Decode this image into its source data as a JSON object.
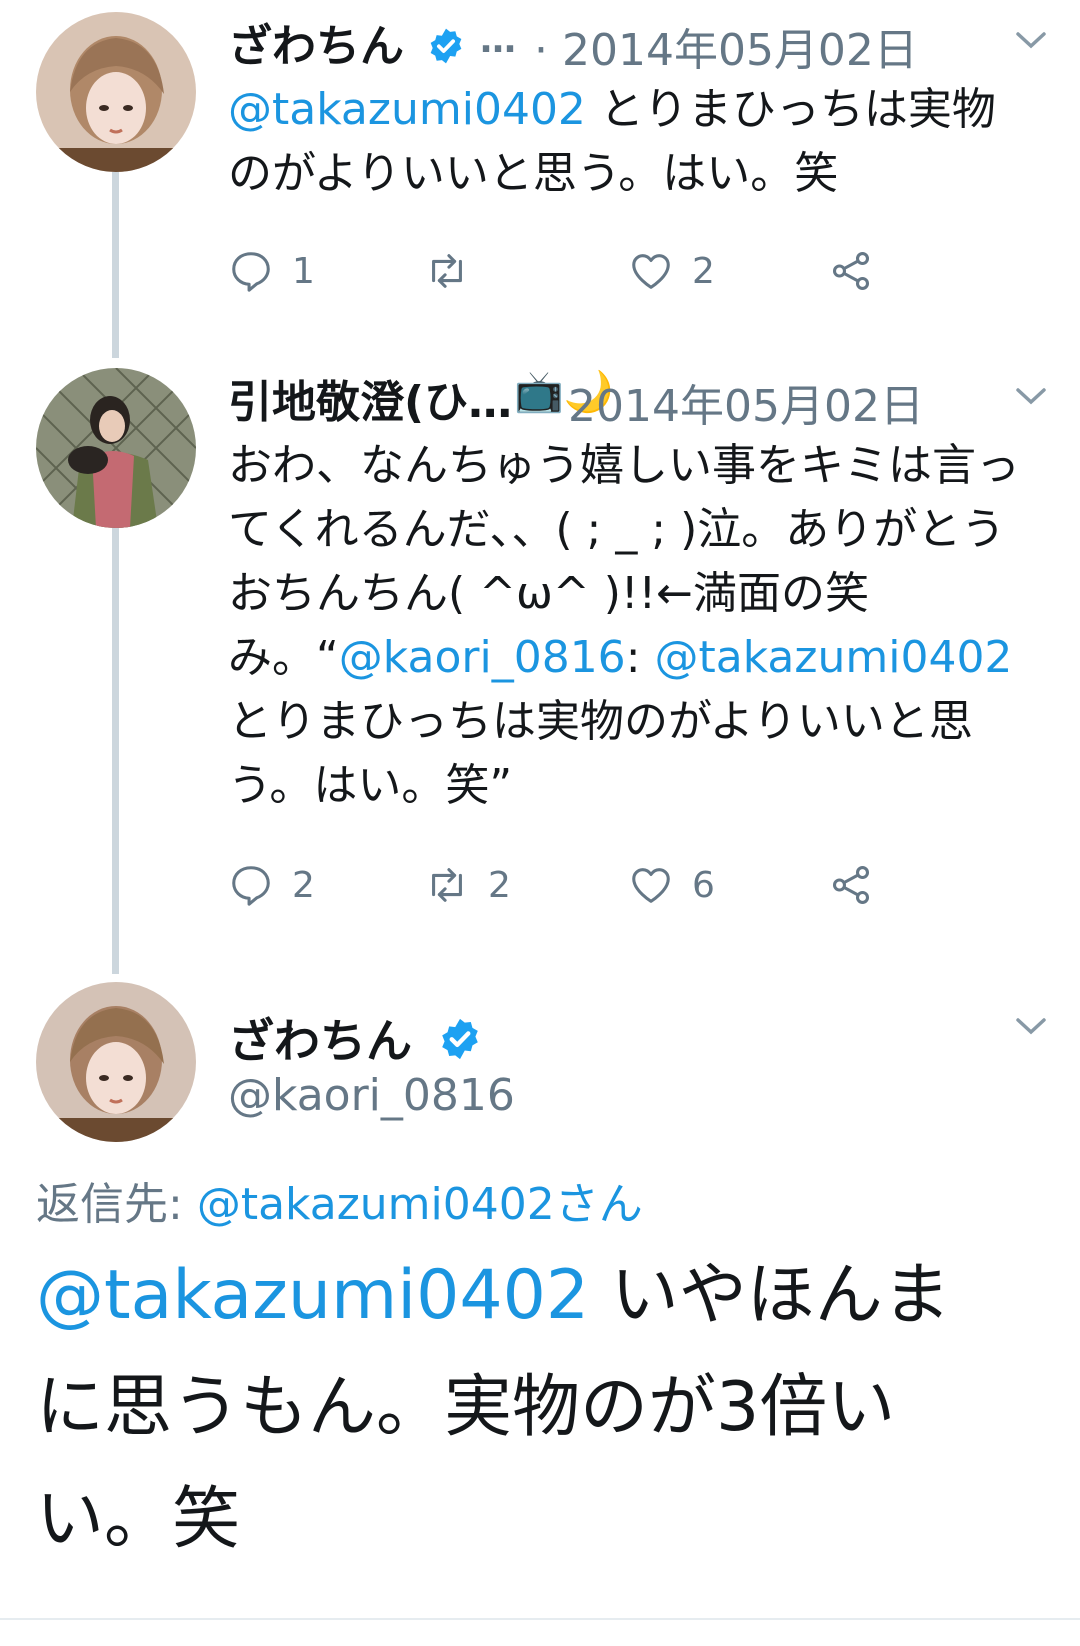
{
  "tweets": [
    {
      "name": "ざわちん",
      "ellipsis": "…",
      "date": "· 2014年05月02日",
      "mention": "@takazumi0402",
      "text": " とりまひっちは実物のがよりいいと思う。はい。笑",
      "reply_count": "1",
      "retweet_count": "",
      "like_count": "2"
    },
    {
      "name": "引地敬澄(ひ…",
      "emoji": "📺🌙",
      "date": "2014年05月02日",
      "text_part1": "おわ、なんちゅう嬉しい事をキミは言ってくれるんだ、、( ; _ ; )泣。ありがとうおちんちん( ^ω^ )!!←満面の笑み。“",
      "mention1": "@kaori_0816",
      "text_part2": ": ",
      "mention2": "@takazumi0402",
      "text_part3": " とりまひっちは実物のがよりいいと思う。はい。笑”",
      "reply_count": "2",
      "retweet_count": "2",
      "like_count": "6"
    }
  ],
  "focus": {
    "name": "ざわちん",
    "handle": "@kaori_0816",
    "reply_label": "返信先: ",
    "reply_target": "@takazumi0402さん",
    "mention": "@takazumi0402",
    "text": " いやほんまに思うもん。実物のが3倍いい。笑"
  },
  "colors": {
    "link": "#1b95e0",
    "muted": "#657786",
    "verified": "#1da1f2",
    "thread": "#ccd6dd"
  },
  "icons": [
    "verified-badge-icon",
    "chevron-down-icon",
    "reply-icon",
    "retweet-icon",
    "like-icon",
    "share-icon"
  ]
}
